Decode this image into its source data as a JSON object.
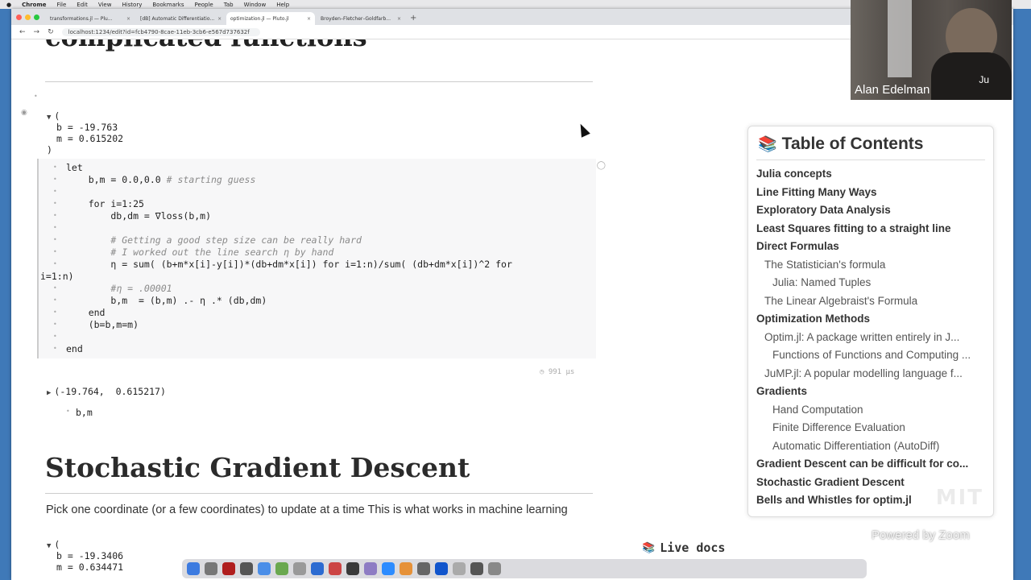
{
  "menubar": {
    "app": "Chrome",
    "items": [
      "File",
      "Edit",
      "View",
      "History",
      "Bookmarks",
      "People",
      "Tab",
      "Window",
      "Help"
    ]
  },
  "browser": {
    "tabs": [
      {
        "label": "transformations.jl — Plu..."
      },
      {
        "label": "[dB] Automatic Differentiatio..."
      },
      {
        "label": "optimization.jl — Pluto.jl",
        "active": true
      },
      {
        "label": "Broyden–Fletcher–Goldfarb..."
      }
    ],
    "url": "localhost:1234/edit?id=fcb4790-8cae-11eb-3cb6-e567d737632f"
  },
  "notebook": {
    "prev_heading": "complicated functions",
    "output1": {
      "open": "(",
      "b_line": "b = -19.763",
      "m_line": "m = 0.615202",
      "close": ")"
    },
    "code": {
      "lines": [
        {
          "text": "let"
        },
        {
          "text": "    b,m = 0.0,0.0 ",
          "comment": "# starting guess"
        },
        {
          "text": ""
        },
        {
          "text": "    for i=1:25"
        },
        {
          "text": "        db,dm = ∇loss(b,m)"
        },
        {
          "text": ""
        },
        {
          "text": "        ",
          "comment": "# Getting a good step size can be really hard"
        },
        {
          "text": "        ",
          "comment": "# I worked out the line search η by hand"
        },
        {
          "text": "        η = sum( (b+m*x[i]-y[i])*(db+dm*x[i]) for i=1:n)/sum( (db+dm*x[i])^2 for"
        },
        {
          "text": "i=1:n)"
        },
        {
          "text": "        ",
          "comment": "#η = .00001"
        },
        {
          "text": "        b,m  = (b,m) .- η .* (db,dm)"
        },
        {
          "text": "    end"
        },
        {
          "text": "    (b=b,m=m)"
        },
        {
          "text": ""
        },
        {
          "text": "end"
        }
      ],
      "runtime": "991 μs"
    },
    "output2": "(-19.764,  0.615217)",
    "code2": "b,m",
    "section_title": "Stochastic Gradient Descent",
    "section_para": "Pick one coordinate (or a few coordinates) to update at a time This is what works in machine learning",
    "output3": {
      "open": "(",
      "b_line": "b = -19.3406",
      "m_line": "m = 0.634471"
    },
    "live_docs": "Live docs"
  },
  "toc": {
    "title": "Table of Contents",
    "items": [
      {
        "label": "Julia concepts",
        "level": 1
      },
      {
        "label": "Line Fitting Many Ways",
        "level": 1
      },
      {
        "label": "Exploratory Data Analysis",
        "level": 1
      },
      {
        "label": "Least Squares fitting to a straight line",
        "level": 1
      },
      {
        "label": "Direct Formulas",
        "level": 1
      },
      {
        "label": "The Statistician's formula",
        "level": 2
      },
      {
        "label": "Julia: Named Tuples",
        "level": 3
      },
      {
        "label": "The Linear Algebraist's Formula",
        "level": 2
      },
      {
        "label": "Optimization Methods",
        "level": 1
      },
      {
        "label": "Optim.jl: A package written entirely in J...",
        "level": 2
      },
      {
        "label": "Functions of Functions and Computing ...",
        "level": 3
      },
      {
        "label": "JuMP.jl: A popular modelling language f...",
        "level": 2
      },
      {
        "label": "Gradients",
        "level": 1
      },
      {
        "label": "Hand Computation",
        "level": 3
      },
      {
        "label": "Finite Difference Evaluation",
        "level": 3
      },
      {
        "label": "Automatic Differentiation (AutoDiff)",
        "level": 3
      },
      {
        "label": "Gradient Descent can be difficult for co...",
        "level": 1
      },
      {
        "label": "Stochastic Gradient Descent",
        "level": 1
      },
      {
        "label": "Bells and Whistles for optim.jl",
        "level": 1
      }
    ]
  },
  "video": {
    "name": "Alan Edelman",
    "badge": "Ju"
  },
  "watermark": "Powered by Zoom"
}
